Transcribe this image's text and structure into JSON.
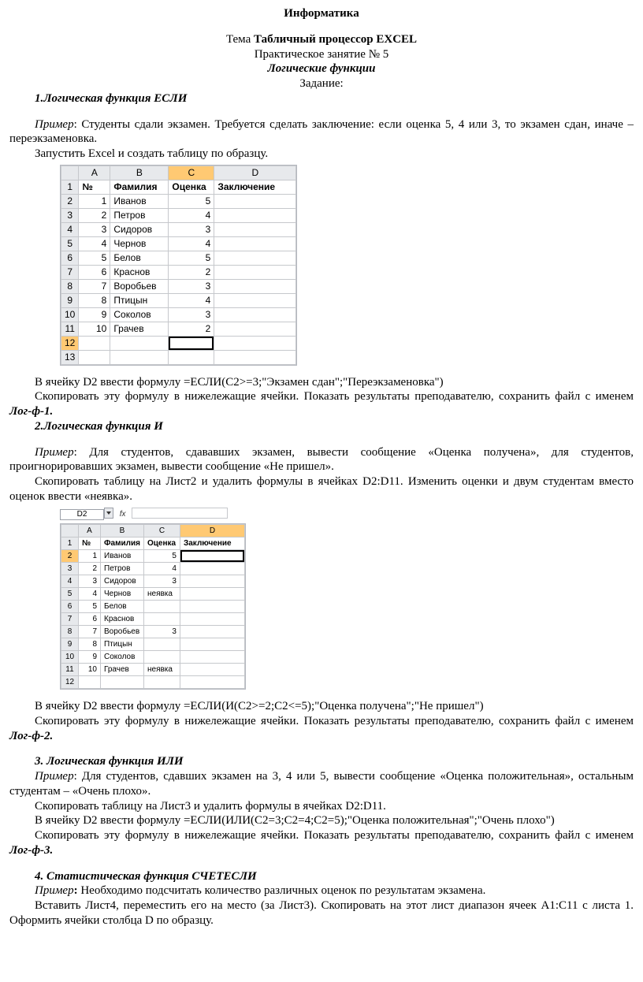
{
  "header": {
    "title": "Информатика",
    "topic_prefix": "Тема ",
    "topic": "Табличный процессор EXCEL",
    "practice": "Практическое занятие № 5",
    "subtitle": "Логические функции",
    "assignment": "Задание:"
  },
  "sec1": {
    "heading": "1.Логическая функция ЕСЛИ",
    "ex_prefix": "Пример",
    "ex_text": ": Студенты сдали экзамен. Требуется сделать заключение: если оценка 5, 4 или 3, то экзамен сдан, иначе – переэкзаменовка.",
    "launch": "Запустить Excel и создать таблицу по образцу.",
    "after1": "В ячейку D2 ввести формулу =ЕСЛИ(С2>=3;\"Экзамен сдан\";\"Переэкзаменовка\")",
    "after2a": "Скопировать эту формулу в нижележащие ячейки. Показать результаты преподавателю, сохранить файл с именем ",
    "after2b": "Лог-ф-1."
  },
  "table1": {
    "cols": [
      "A",
      "B",
      "C",
      "D"
    ],
    "selected_col": "C",
    "headers": {
      "A": "№",
      "B": "Фамилия",
      "C": "Оценка",
      "D": "Заключение"
    },
    "rows": [
      {
        "r": "2",
        "A": "1",
        "B": "Иванов",
        "C": "5",
        "D": ""
      },
      {
        "r": "3",
        "A": "2",
        "B": "Петров",
        "C": "4",
        "D": ""
      },
      {
        "r": "4",
        "A": "3",
        "B": "Сидоров",
        "C": "3",
        "D": ""
      },
      {
        "r": "5",
        "A": "4",
        "B": "Чернов",
        "C": "4",
        "D": ""
      },
      {
        "r": "6",
        "A": "5",
        "B": "Белов",
        "C": "5",
        "D": ""
      },
      {
        "r": "7",
        "A": "6",
        "B": "Краснов",
        "C": "2",
        "D": ""
      },
      {
        "r": "8",
        "A": "7",
        "B": "Воробьев",
        "C": "3",
        "D": ""
      },
      {
        "r": "9",
        "A": "8",
        "B": "Птицын",
        "C": "4",
        "D": ""
      },
      {
        "r": "10",
        "A": "9",
        "B": "Соколов",
        "C": "3",
        "D": ""
      },
      {
        "r": "11",
        "A": "10",
        "B": "Грачев",
        "C": "2",
        "D": ""
      }
    ],
    "extra_rows": [
      "12",
      "13"
    ],
    "selected_row": "12",
    "sel_cell": "C12"
  },
  "sec2": {
    "heading": "2.Логическая функция И",
    "ex_prefix": "Пример",
    "ex_text": ": Для студентов, сдававших экзамен, вывести сообщение «Оценка получена», для студентов, проигнорировавших экзамен, вывести сообщение «Не пришел».",
    "copy": "Скопировать таблицу на Лист2 и удалить формулы в ячейках D2:D11. Изменить оценки и двум студентам вместо оценок ввести «неявка».",
    "namebox": "D2",
    "fx": "fx",
    "after1": "В ячейку D2 ввести формулу =ЕСЛИ(И(С2>=2;С2<=5);\"Оценка получена\";\"Не пришел\")",
    "after2a": "Скопировать эту формулу в нижележащие ячейки. Показать результаты преподавателю, сохранить файл с именем ",
    "after2b": "Лог-ф-2."
  },
  "table2": {
    "cols": [
      "A",
      "B",
      "C",
      "D"
    ],
    "selected_col": "D",
    "selected_row": "2",
    "headers": {
      "A": "№",
      "B": "Фамилия",
      "C": "Оценка",
      "D": "Заключение"
    },
    "rows": [
      {
        "r": "2",
        "A": "1",
        "B": "Иванов",
        "C": "5",
        "D": ""
      },
      {
        "r": "3",
        "A": "2",
        "B": "Петров",
        "C": "4",
        "D": ""
      },
      {
        "r": "4",
        "A": "3",
        "B": "Сидоров",
        "C": "3",
        "D": ""
      },
      {
        "r": "5",
        "A": "4",
        "B": "Чернов",
        "C": "неявка",
        "D": ""
      },
      {
        "r": "6",
        "A": "5",
        "B": "Белов",
        "C": "",
        "D": ""
      },
      {
        "r": "7",
        "A": "6",
        "B": "Краснов",
        "C": "",
        "D": ""
      },
      {
        "r": "8",
        "A": "7",
        "B": "Воробьев",
        "C": "3",
        "D": ""
      },
      {
        "r": "9",
        "A": "8",
        "B": "Птицын",
        "C": "",
        "D": ""
      },
      {
        "r": "10",
        "A": "9",
        "B": "Соколов",
        "C": "",
        "D": ""
      },
      {
        "r": "11",
        "A": "10",
        "B": "Грачев",
        "C": "неявка",
        "D": ""
      }
    ],
    "extra_rows": [
      "12"
    ]
  },
  "sec3": {
    "heading": "3. Логическая функция ИЛИ",
    "ex_prefix": "Пример",
    "ex_text": ": Для студентов, сдавших экзамен на 3, 4 или 5, вывести сообщение «Оценка положительная», остальным студентам – «Очень плохо».",
    "copy": "Скопировать таблицу на Лист3 и удалить формулы в ячейках D2:D11.",
    "formula": "В ячейку D2 ввести формулу =ЕСЛИ(ИЛИ(С2=3;С2=4;С2=5);\"Оценка положительная\";\"Очень плохо\")",
    "after2a": "Скопировать эту формулу в нижележащие ячейки. Показать результаты преподавателю, сохранить файл с именем ",
    "after2b": "Лог-ф-3."
  },
  "sec4": {
    "heading": "4. Статистическая  функция СЧЕТЕСЛИ",
    "ex_prefix": "Пример",
    "ex_text": " Необходимо подсчитать количество различных оценок по результатам экзамена.",
    "line2": "Вставить Лист4, переместить его на место (за Лист3). Скопировать на этот лист диапазон ячеек А1:С11 с листа 1. Оформить ячейки столбца D по образцу."
  }
}
